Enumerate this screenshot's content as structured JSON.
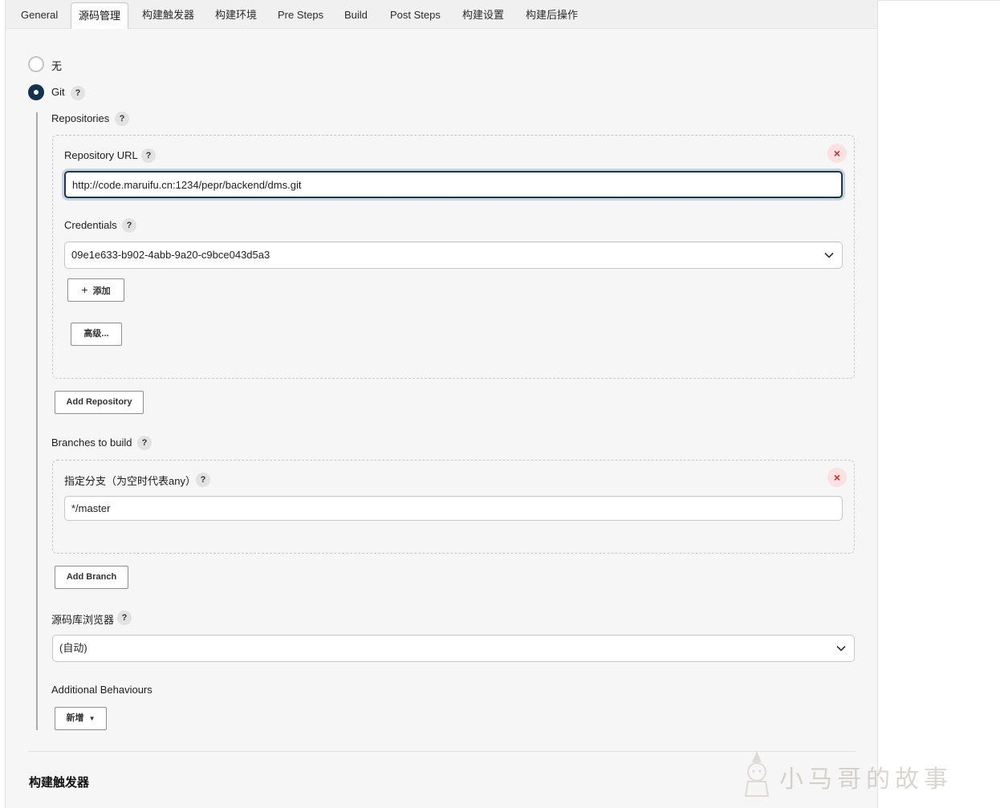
{
  "tabs": [
    "General",
    "源码管理",
    "构建触发器",
    "构建环境",
    "Pre Steps",
    "Build",
    "Post Steps",
    "构建设置",
    "构建后操作"
  ],
  "active_tab": "源码管理",
  "scm": {
    "option_none": "无",
    "option_git": "Git",
    "selected": "Git"
  },
  "repositories": {
    "label": "Repositories",
    "repo_url_label": "Repository URL",
    "repo_url_value": "http://code.maruifu.cn:1234/pepr/backend/dms.git",
    "credentials_label": "Credentials",
    "credentials_value": "09e1e633-b902-4abb-9a20-c9bce043d5a3",
    "add_button": "添加",
    "advanced_button": "高级...",
    "add_repository_button": "Add Repository"
  },
  "branches": {
    "label": "Branches to build",
    "branch_spec_label": "指定分支（为空时代表any）",
    "branch_spec_value": "*/master",
    "add_branch_button": "Add Branch"
  },
  "browser": {
    "label": "源码库浏览器",
    "value": "(自动)"
  },
  "behaviours": {
    "label": "Additional Behaviours",
    "add_button": "新增"
  },
  "next_section_title": "构建触发器",
  "help_symbol": "?",
  "close_symbol": "×",
  "watermark_text": "小马哥的故事",
  "colors": {
    "radio_checked": "#14314d",
    "focus_border": "#1d3651",
    "close_bg": "#fbe1e1",
    "close_fg": "#d02a2a"
  }
}
